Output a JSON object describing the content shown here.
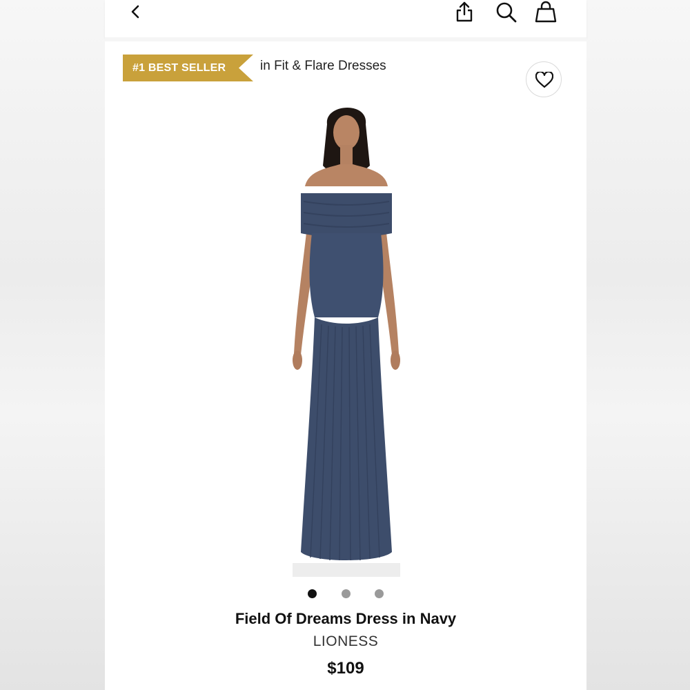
{
  "header": {
    "icons": {
      "back": "chevron-left-icon",
      "share": "share-icon",
      "search": "search-icon",
      "bag": "shopping-bag-icon"
    }
  },
  "badge": {
    "label": "#1 BEST SELLER",
    "category_text": "in Fit & Flare Dresses",
    "color": "#c9a13b"
  },
  "wishlist": {
    "icon": "heart-icon"
  },
  "gallery": {
    "image_count": 3,
    "active_index": 0,
    "dress_color": "#3d4d6b"
  },
  "product": {
    "title": "Field Of Dreams Dress in Navy",
    "brand": "LIONESS",
    "price": "$109"
  }
}
